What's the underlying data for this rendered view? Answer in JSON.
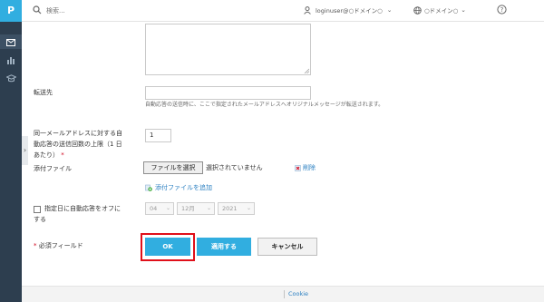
{
  "app": {
    "logo_letter": "P"
  },
  "topbar": {
    "search_placeholder": "検索...",
    "user": "loginuser@○ドメイン○",
    "domain": "○ドメイン○"
  },
  "form": {
    "forward_label": "転送先",
    "forward_hint": "自動応答の送信時に、ここで指定されたメールアドレスへオリジナルメッセージが転送されます。",
    "limit_label_1": "同一メールアドレスに対する自",
    "limit_label_2": "動応答の送信回数の上限（1 日",
    "limit_label_3": "あたり）",
    "required_mark": "*",
    "limit_value": "1",
    "attachment_label": "添付ファイル",
    "choose_file_button": "ファイルを選択",
    "no_file_text": "選択されていません",
    "delete_link": "削除",
    "add_attachment_link": "添付ファイルを追加",
    "auto_off_label_1": "指定日に自動応答をオフに",
    "auto_off_label_2": "する",
    "day": "04",
    "month": "12月",
    "year": "2021",
    "required_field_label": "必須フィールド"
  },
  "buttons": {
    "ok": "OK",
    "apply": "適用する",
    "cancel": "キャンセル"
  },
  "footer": {
    "cookie_link": "Cookie"
  },
  "colors": {
    "sidebar": "#2d3e4f",
    "accent": "#31aee0",
    "highlight": "#e0101a",
    "link": "#2a7fc1"
  }
}
